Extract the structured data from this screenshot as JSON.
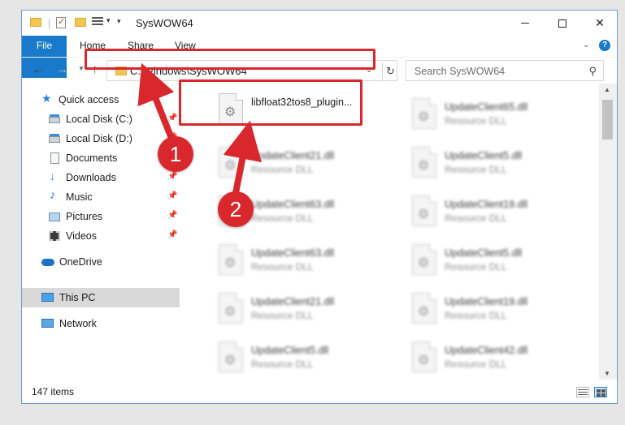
{
  "window": {
    "title": "SysWOW64",
    "title_bar_buttons": [
      "minimize",
      "maximize",
      "close"
    ]
  },
  "ribbon": {
    "tabs": [
      {
        "label": "File",
        "active": true
      },
      {
        "label": "Home"
      },
      {
        "label": "Share"
      },
      {
        "label": "View"
      }
    ],
    "help_label": "?"
  },
  "address_bar": {
    "path": "C:\\Windows\\SysWOW64",
    "search_placeholder": "Search SysWOW64"
  },
  "nav_pane": {
    "items": [
      {
        "label": "Quick access",
        "icon": "star-icon"
      },
      {
        "label": "Local Disk (C:)",
        "icon": "drive-icon",
        "pinned": true
      },
      {
        "label": "Local Disk (D:)",
        "icon": "drive-icon",
        "pinned": true
      },
      {
        "label": "Documents",
        "icon": "documents-icon",
        "pinned": true
      },
      {
        "label": "Downloads",
        "icon": "download-icon",
        "pinned": true
      },
      {
        "label": "Music",
        "icon": "music-icon",
        "pinned": true
      },
      {
        "label": "Pictures",
        "icon": "pictures-icon",
        "pinned": true
      },
      {
        "label": "Videos",
        "icon": "videos-icon",
        "pinned": true
      },
      {
        "label": "OneDrive",
        "icon": "cloud-icon"
      },
      {
        "label": "This PC",
        "icon": "pc-icon",
        "selected": true
      },
      {
        "label": "Network",
        "icon": "network-icon"
      }
    ]
  },
  "files": [
    {
      "name": "libfloat32tos8_plugin...",
      "type": ""
    },
    {
      "name": "UpdateClient65.dll",
      "type": "Resource DLL"
    },
    {
      "name": "UpdateClient21.dll",
      "type": "Resource DLL"
    },
    {
      "name": "UpdateClient5.dll",
      "type": "Resource DLL"
    },
    {
      "name": "UpdateClient63.dll",
      "type": "Resource DLL"
    },
    {
      "name": "UpdateClient19.dll",
      "type": "Resource DLL"
    },
    {
      "name": "UpdateClient63.dll",
      "type": "Resource DLL"
    },
    {
      "name": "UpdateClient5.dll",
      "type": "Resource DLL"
    },
    {
      "name": "UpdateClient21.dll",
      "type": "Resource DLL"
    },
    {
      "name": "UpdateClient19.dll",
      "type": "Resource DLL"
    },
    {
      "name": "UpdateClient5.dll",
      "type": "Resource DLL"
    },
    {
      "name": "UpdateClient42.dll",
      "type": "Resource DLL"
    }
  ],
  "status": {
    "item_count": "147 items"
  },
  "callouts": [
    "1",
    "2"
  ],
  "colors": {
    "accent": "#1979ca",
    "highlight_red": "#d8282e",
    "folder_yellow": "#f4c553"
  }
}
